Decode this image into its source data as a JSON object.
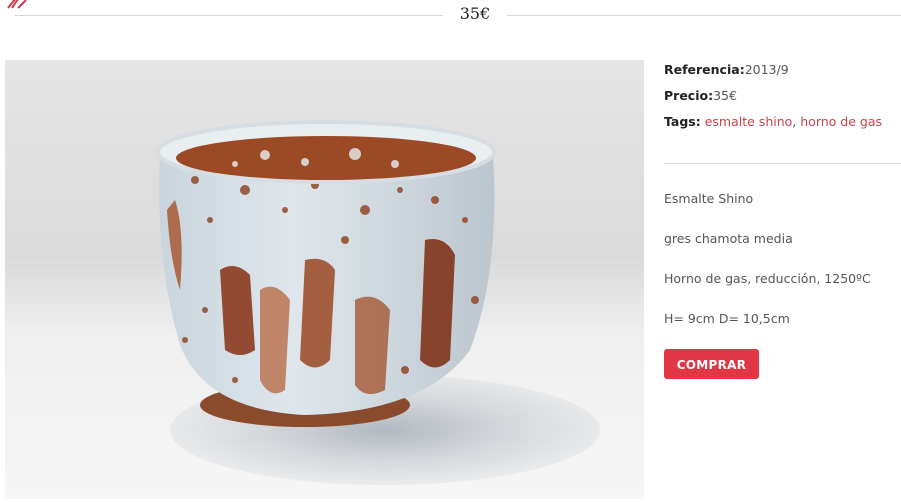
{
  "header": {
    "price_heading": "35€",
    "logo_icon": "brand-logo-icon"
  },
  "product": {
    "image_icon": "product-photo-tea-bowl",
    "reference_label": "Referencia:",
    "reference_value": "2013/9",
    "price_label": "Precio:",
    "price_value": "35€",
    "tags_label": "Tags:",
    "tags": [
      "esmalte shino",
      "horno de gas"
    ],
    "tag_separator": ", ",
    "description": [
      "Esmalte Shino",
      "gres chamota media",
      "Horno de gas, reducción, 1250ºC",
      "H= 9cm D= 10,5cm"
    ],
    "buy_label": "COMPRAR"
  },
  "colors": {
    "accent": "#e03646",
    "tag_link": "#c9434a"
  }
}
